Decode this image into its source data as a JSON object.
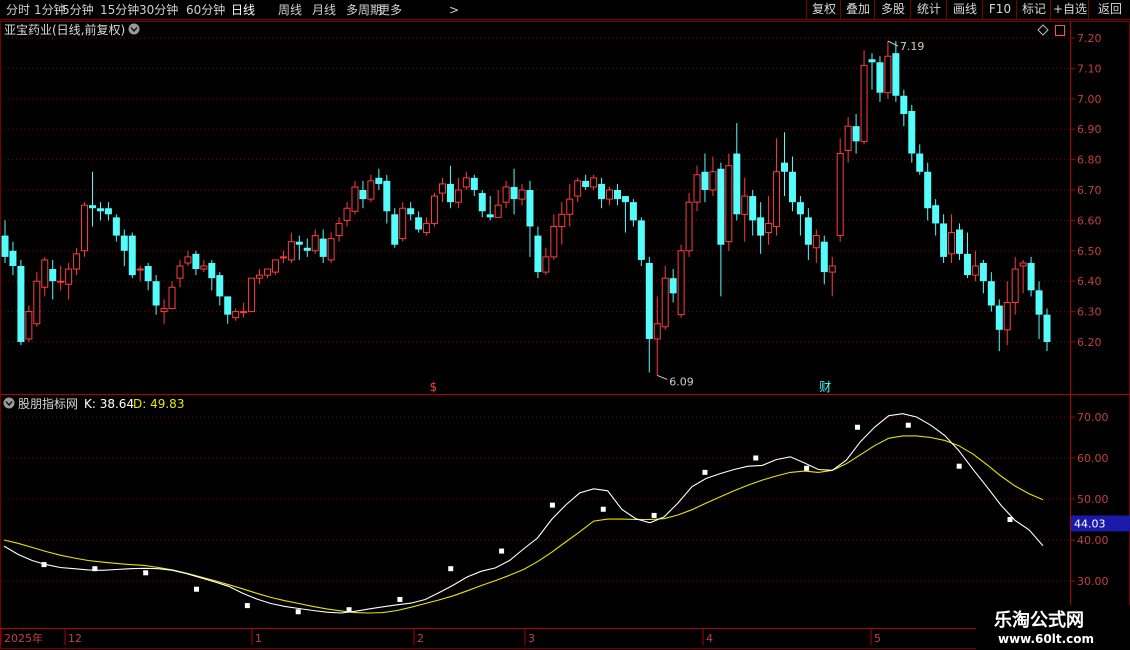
{
  "toolbar": {
    "periods": [
      "分时",
      "1分钟",
      "5分钟",
      "15分钟",
      "30分钟",
      "60分钟",
      "日线",
      "周线",
      "月线",
      "多周期",
      "更多"
    ],
    "active_period": "日线",
    "more_arrow": ">",
    "right_buttons": [
      "复权",
      "叠加",
      "多股",
      "统计",
      "画线",
      "F10",
      "标记",
      "+自选",
      "返回"
    ]
  },
  "colors": {
    "up": "#ff3c3c",
    "down": "#54fcfc",
    "k_line": "#ffffff",
    "d_line": "#e6e600",
    "grid": "#8b0000",
    "axis_text": "#c04040",
    "price_text": "#d0d0d0"
  },
  "chart_data": [
    {
      "type": "candlestick",
      "title": "亚宝药业(日线,前复权)",
      "ylim": [
        6.08,
        7.26
      ],
      "yticks": [
        6.2,
        6.3,
        6.4,
        6.5,
        6.6,
        6.7,
        6.8,
        6.9,
        7.0,
        7.1,
        7.2
      ],
      "ytick_labels": [
        "6.20",
        "6.30",
        "6.40",
        "6.50",
        "6.60",
        "6.70",
        "6.80",
        "6.90",
        "7.00",
        "7.10",
        "7.20"
      ],
      "annotations": {
        "high_label": "7.19",
        "high_value": 7.19,
        "low_label": "6.09",
        "low_value": 6.09
      },
      "markers": [
        {
          "label": "$",
          "index": 54,
          "color": "#ff3c3c"
        },
        {
          "label": "财",
          "index": 103,
          "color": "#54fcfc"
        }
      ],
      "candles": [
        [
          6.55,
          6.48,
          6.6,
          6.46
        ],
        [
          6.5,
          6.45,
          6.53,
          6.42
        ],
        [
          6.45,
          6.2,
          6.47,
          6.19
        ],
        [
          6.21,
          6.3,
          6.32,
          6.2
        ],
        [
          6.26,
          6.4,
          6.43,
          6.25
        ],
        [
          6.38,
          6.47,
          6.48,
          6.35
        ],
        [
          6.44,
          6.4,
          6.47,
          6.34
        ],
        [
          6.4,
          6.4,
          6.45,
          6.37
        ],
        [
          6.39,
          6.44,
          6.46,
          6.34
        ],
        [
          6.44,
          6.49,
          6.51,
          6.42
        ],
        [
          6.5,
          6.65,
          6.66,
          6.48
        ],
        [
          6.65,
          6.64,
          6.76,
          6.58
        ],
        [
          6.64,
          6.63,
          6.66,
          6.6
        ],
        [
          6.64,
          6.62,
          6.66,
          6.6
        ],
        [
          6.61,
          6.55,
          6.62,
          6.53
        ],
        [
          6.55,
          6.5,
          6.57,
          6.45
        ],
        [
          6.55,
          6.42,
          6.56,
          6.41
        ],
        [
          6.44,
          6.44,
          6.45,
          6.4
        ],
        [
          6.45,
          6.4,
          6.46,
          6.37
        ],
        [
          6.4,
          6.32,
          6.42,
          6.29
        ],
        [
          6.3,
          6.31,
          6.34,
          6.26
        ],
        [
          6.31,
          6.38,
          6.4,
          6.31
        ],
        [
          6.41,
          6.45,
          6.47,
          6.38
        ],
        [
          6.46,
          6.48,
          6.5,
          6.45
        ],
        [
          6.49,
          6.44,
          6.5,
          6.42
        ],
        [
          6.44,
          6.45,
          6.47,
          6.43
        ],
        [
          6.46,
          6.41,
          6.47,
          6.37
        ],
        [
          6.42,
          6.35,
          6.43,
          6.32
        ],
        [
          6.35,
          6.29,
          6.35,
          6.26
        ],
        [
          6.28,
          6.3,
          6.31,
          6.27
        ],
        [
          6.3,
          6.3,
          6.33,
          6.28
        ],
        [
          6.3,
          6.41,
          6.41,
          6.3
        ],
        [
          6.41,
          6.42,
          6.44,
          6.39
        ],
        [
          6.42,
          6.44,
          6.44,
          6.41
        ],
        [
          6.43,
          6.47,
          6.47,
          6.42
        ],
        [
          6.48,
          6.48,
          6.5,
          6.46
        ],
        [
          6.47,
          6.53,
          6.56,
          6.46
        ],
        [
          6.53,
          6.52,
          6.55,
          6.47
        ],
        [
          6.51,
          6.5,
          6.54,
          6.48
        ],
        [
          6.5,
          6.55,
          6.57,
          6.49
        ],
        [
          6.54,
          6.48,
          6.57,
          6.46
        ],
        [
          6.47,
          6.54,
          6.56,
          6.46
        ],
        [
          6.55,
          6.59,
          6.61,
          6.53
        ],
        [
          6.6,
          6.64,
          6.66,
          6.58
        ],
        [
          6.63,
          6.71,
          6.73,
          6.62
        ],
        [
          6.7,
          6.67,
          6.73,
          6.64
        ],
        [
          6.67,
          6.73,
          6.75,
          6.66
        ],
        [
          6.74,
          6.72,
          6.77,
          6.7
        ],
        [
          6.73,
          6.63,
          6.75,
          6.59
        ],
        [
          6.62,
          6.52,
          6.64,
          6.51
        ],
        [
          6.54,
          6.64,
          6.66,
          6.53
        ],
        [
          6.64,
          6.62,
          6.66,
          6.6
        ],
        [
          6.61,
          6.57,
          6.63,
          6.56
        ],
        [
          6.56,
          6.59,
          6.61,
          6.55
        ],
        [
          6.59,
          6.68,
          6.69,
          6.58
        ],
        [
          6.69,
          6.72,
          6.74,
          6.66
        ],
        [
          6.72,
          6.66,
          6.78,
          6.64
        ],
        [
          6.66,
          6.7,
          6.74,
          6.64
        ],
        [
          6.71,
          6.74,
          6.76,
          6.7
        ],
        [
          6.74,
          6.7,
          6.75,
          6.68
        ],
        [
          6.69,
          6.63,
          6.7,
          6.61
        ],
        [
          6.62,
          6.61,
          6.68,
          6.6
        ],
        [
          6.61,
          6.65,
          6.7,
          6.62
        ],
        [
          6.66,
          6.71,
          6.73,
          6.64
        ],
        [
          6.71,
          6.67,
          6.77,
          6.62
        ],
        [
          6.67,
          6.7,
          6.72,
          6.65
        ],
        [
          6.7,
          6.58,
          6.73,
          6.48
        ],
        [
          6.55,
          6.43,
          6.58,
          6.41
        ],
        [
          6.43,
          6.48,
          6.51,
          6.42
        ],
        [
          6.48,
          6.58,
          6.62,
          6.47
        ],
        [
          6.58,
          6.62,
          6.66,
          6.52
        ],
        [
          6.62,
          6.67,
          6.72,
          6.58
        ],
        [
          6.68,
          6.73,
          6.74,
          6.66
        ],
        [
          6.73,
          6.71,
          6.75,
          6.7
        ],
        [
          6.71,
          6.74,
          6.75,
          6.7
        ],
        [
          6.72,
          6.67,
          6.74,
          6.64
        ],
        [
          6.67,
          6.7,
          6.71,
          6.65
        ],
        [
          6.7,
          6.67,
          6.72,
          6.65
        ],
        [
          6.68,
          6.66,
          6.68,
          6.56
        ],
        [
          6.66,
          6.6,
          6.67,
          6.58
        ],
        [
          6.6,
          6.47,
          6.61,
          6.45
        ],
        [
          6.46,
          6.21,
          6.48,
          6.1
        ],
        [
          6.21,
          6.26,
          6.35,
          6.09
        ],
        [
          6.25,
          6.41,
          6.45,
          6.24
        ],
        [
          6.41,
          6.36,
          6.44,
          6.33
        ],
        [
          6.29,
          6.5,
          6.52,
          6.28
        ],
        [
          6.5,
          6.66,
          6.69,
          6.48
        ],
        [
          6.66,
          6.75,
          6.78,
          6.63
        ],
        [
          6.76,
          6.7,
          6.82,
          6.66
        ],
        [
          6.7,
          6.76,
          6.81,
          6.68
        ],
        [
          6.77,
          6.52,
          6.79,
          6.35
        ],
        [
          6.53,
          6.78,
          6.82,
          6.5
        ],
        [
          6.82,
          6.62,
          6.92,
          6.6
        ],
        [
          6.62,
          6.68,
          6.74,
          6.53
        ],
        [
          6.68,
          6.6,
          6.7,
          6.55
        ],
        [
          6.61,
          6.55,
          6.66,
          6.49
        ],
        [
          6.56,
          6.59,
          6.68,
          6.52
        ],
        [
          6.58,
          6.76,
          6.87,
          6.55
        ],
        [
          6.79,
          6.76,
          6.89,
          6.68
        ],
        [
          6.76,
          6.66,
          6.81,
          6.63
        ],
        [
          6.66,
          6.62,
          6.68,
          6.55
        ],
        [
          6.61,
          6.52,
          6.64,
          6.47
        ],
        [
          6.51,
          6.55,
          6.57,
          6.46
        ],
        [
          6.53,
          6.43,
          6.55,
          6.39
        ],
        [
          6.43,
          6.45,
          6.48,
          6.35
        ],
        [
          6.55,
          6.82,
          6.87,
          6.53
        ],
        [
          6.83,
          6.91,
          6.94,
          6.79
        ],
        [
          6.91,
          6.86,
          6.95,
          6.82
        ],
        [
          6.86,
          7.11,
          7.16,
          6.85
        ],
        [
          7.13,
          7.12,
          7.15,
          7.03
        ],
        [
          7.12,
          7.02,
          7.14,
          6.99
        ],
        [
          7.02,
          7.14,
          7.19,
          7.0
        ],
        [
          7.15,
          7.01,
          7.19,
          6.99
        ],
        [
          7.01,
          6.95,
          7.03,
          6.91
        ],
        [
          6.96,
          6.82,
          6.98,
          6.79
        ],
        [
          6.82,
          6.76,
          6.85,
          6.75
        ],
        [
          6.76,
          6.64,
          6.79,
          6.6
        ],
        [
          6.65,
          6.59,
          6.67,
          6.55
        ],
        [
          6.59,
          6.48,
          6.62,
          6.46
        ],
        [
          6.49,
          6.56,
          6.62,
          6.46
        ],
        [
          6.57,
          6.49,
          6.59,
          6.47
        ],
        [
          6.49,
          6.42,
          6.56,
          6.41
        ],
        [
          6.42,
          6.45,
          6.5,
          6.4
        ],
        [
          6.46,
          6.4,
          6.47,
          6.36
        ],
        [
          6.4,
          6.32,
          6.43,
          6.3
        ],
        [
          6.32,
          6.24,
          6.34,
          6.17
        ],
        [
          6.24,
          6.33,
          6.4,
          6.19
        ],
        [
          6.33,
          6.44,
          6.48,
          6.29
        ],
        [
          6.45,
          6.46,
          6.47,
          6.36
        ],
        [
          6.46,
          6.37,
          6.48,
          6.35
        ],
        [
          6.37,
          6.29,
          6.4,
          6.21
        ],
        [
          6.29,
          6.2,
          6.31,
          6.17
        ]
      ]
    },
    {
      "type": "line",
      "title": "股朋指标网",
      "k_label": "K: 38.64",
      "d_label": "D: 49.83",
      "ylim": [
        26,
        74
      ],
      "yticks": [
        30,
        40,
        50,
        60,
        70
      ],
      "ytick_labels": [
        "30.00",
        "40.00",
        "50.00",
        "60.00",
        "70.00"
      ],
      "cursor_label": "44.03",
      "cursor_value": 44.03,
      "series": [
        {
          "name": "K",
          "values": [
            38.5,
            36.5,
            35.0,
            34.0,
            33.3,
            33.0,
            32.7,
            32.6,
            32.8,
            33.0,
            33.1,
            33.0,
            32.6,
            31.8,
            30.8,
            29.8,
            28.7,
            27.0,
            25.6,
            24.5,
            23.8,
            23.3,
            22.8,
            22.4,
            22.2,
            22.6,
            23.2,
            23.7,
            24.2,
            24.6,
            25.5,
            27.2,
            29.0,
            31.0,
            32.4,
            33.2,
            35.0,
            37.8,
            40.5,
            45.0,
            48.5,
            51.5,
            52.5,
            52.0,
            47.5,
            45.2,
            44.2,
            45.6,
            49.0,
            53.0,
            55.0,
            56.2,
            57.2,
            58.0,
            58.2,
            59.6,
            60.3,
            58.8,
            57.2,
            57.0,
            59.5,
            64.0,
            67.5,
            70.3,
            70.8,
            70.0,
            68.0,
            65.5,
            61.8,
            57.3,
            53.0,
            48.5,
            44.8,
            42.5,
            38.6
          ]
        },
        {
          "name": "D",
          "values": [
            40.0,
            39.2,
            38.2,
            37.2,
            36.3,
            35.6,
            35.0,
            34.6,
            34.3,
            34.0,
            33.8,
            33.3,
            32.7,
            31.9,
            31.0,
            30.1,
            29.1,
            28.1,
            27.0,
            26.0,
            25.2,
            24.5,
            23.8,
            23.2,
            22.7,
            22.3,
            22.2,
            22.3,
            22.8,
            23.6,
            24.5,
            25.4,
            26.4,
            27.6,
            28.9,
            30.1,
            31.4,
            32.8,
            34.7,
            37.0,
            39.5,
            42.0,
            44.6,
            45.1,
            45.1,
            45.0,
            45.0,
            45.2,
            46.1,
            47.4,
            49.0,
            50.5,
            52.0,
            53.4,
            54.6,
            55.6,
            56.5,
            56.8,
            56.5,
            57.0,
            58.6,
            60.8,
            63.0,
            64.8,
            65.4,
            65.4,
            65.0,
            64.3,
            63.0,
            61.0,
            58.4,
            55.6,
            53.2,
            51.3,
            49.8
          ]
        },
        {
          "name": "markers",
          "values": [
            34.0,
            33.0,
            32.0,
            28.0,
            24.0,
            22.5,
            23.0,
            25.5,
            33.0,
            37.3,
            48.5,
            47.5,
            46.0,
            56.5,
            60.0,
            57.5,
            67.5,
            68.0,
            58.0,
            45.0
          ]
        }
      ]
    }
  ],
  "time_axis": {
    "labels": [
      "2025年",
      "12",
      "1",
      "2",
      "3",
      "4",
      "5"
    ]
  },
  "watermark": {
    "title": "乐淘公式网",
    "url": "www.60lt.com"
  }
}
